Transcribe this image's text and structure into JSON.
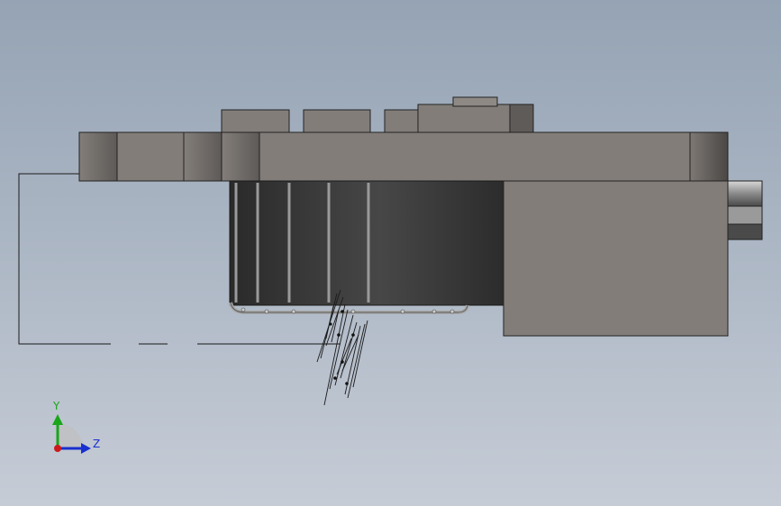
{
  "colors": {
    "background_top": "#95a3b4",
    "background_bottom": "#c6ccd6",
    "body_gray": "#827d79",
    "dark_cylinder": "#3a3a3a",
    "axis_y": "#1aa51a",
    "axis_z": "#1a2fcf",
    "axis_x": "#cc1a1a"
  },
  "triad": {
    "y_label": "Y",
    "z_label": "Z",
    "y_icon": "arrow-up-icon",
    "z_icon": "arrow-right-icon"
  }
}
